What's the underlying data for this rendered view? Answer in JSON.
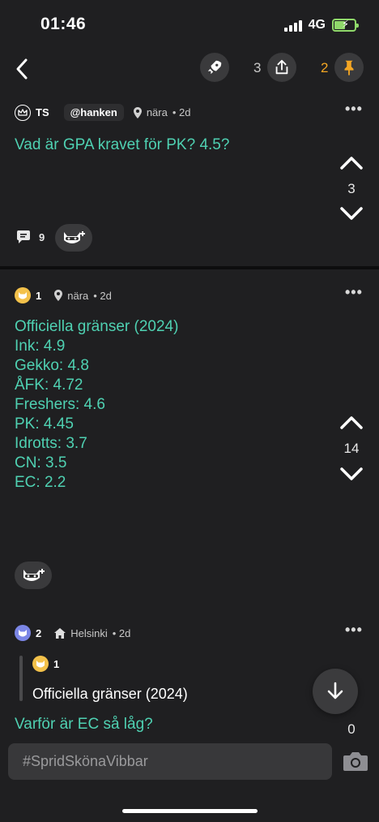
{
  "status_bar": {
    "time": "01:46",
    "network": "4G"
  },
  "nav": {
    "share_count": "3",
    "pin_count": "2"
  },
  "post": {
    "author_initials": "TS",
    "handle": "@hanken",
    "location": "nära",
    "time": "• 2d",
    "text": "Vad är GPA kravet för PK? 4.5?",
    "votes": "3",
    "comment_count": "9"
  },
  "comments": [
    {
      "author_number": "1",
      "location": "nära",
      "time": "• 2d",
      "lines": [
        "Officiella gränser (2024)",
        "Ink: 4.9",
        "Gekko: 4.8",
        "ÅFK: 4.72",
        "Freshers: 4.6",
        "PK: 4.45",
        "Idrotts: 3.7",
        "CN: 3.5",
        "EC: 2.2"
      ],
      "votes": "14"
    },
    {
      "author_number": "2",
      "location": "Helsinki",
      "time": "• 2d",
      "quote_author": "1",
      "quote_text": "Officiella gränser (2024)",
      "text": "Varför är EC så låg?",
      "votes": "0"
    }
  ],
  "composer": {
    "placeholder": "#SpridSkönaVibbar"
  },
  "colors": {
    "accent_text": "#4fd1b2",
    "pin_orange": "#f4a623",
    "background": "#1f1f21"
  },
  "icons": [
    "back-chevron-icon",
    "rocket-icon",
    "share-icon",
    "pin-icon",
    "crown-icon",
    "location-pin-icon",
    "more-dots-icon",
    "upvote-icon",
    "downvote-icon",
    "comment-bubble-icon",
    "raccoon-add-icon",
    "house-icon",
    "arrow-down-icon",
    "camera-icon"
  ]
}
